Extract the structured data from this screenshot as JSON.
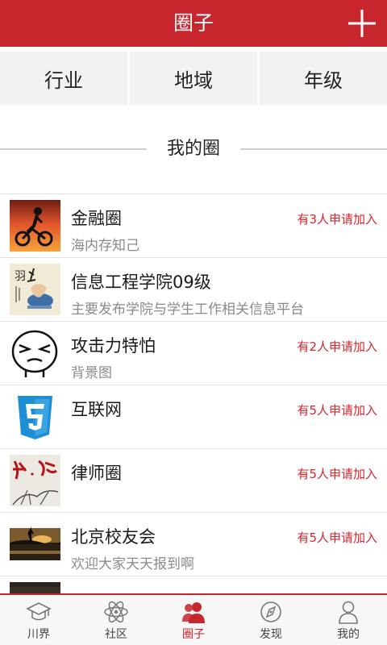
{
  "header": {
    "title": "圈子",
    "add_icon": "plus-icon"
  },
  "filters": [
    {
      "label": "行业"
    },
    {
      "label": "地域"
    },
    {
      "label": "年级"
    }
  ],
  "section": {
    "title": "我的圈"
  },
  "circles": [
    {
      "name": "金融圈",
      "desc": "海内存知己",
      "request": "有3人申请加入",
      "thumb": "cyclist-sunset-image"
    },
    {
      "name": "信息工程学院09级",
      "desc": "主要发布学院与学生工作相关信息平台",
      "request": "",
      "thumb": "calligraphy-painting-image"
    },
    {
      "name": "攻击力特怕",
      "desc": "背景图",
      "request": "有2人申请加入",
      "thumb": "meme-face-image"
    },
    {
      "name": "互联网",
      "desc": "",
      "request": "有5人申请加入",
      "thumb": "html5-logo-image"
    },
    {
      "name": "律师圈",
      "desc": "",
      "request": "有5人申请加入",
      "thumb": "law-calligraphy-image"
    },
    {
      "name": "北京校友会",
      "desc": "欢迎大家天天报到啊",
      "request": "有5人申请加入",
      "thumb": "lake-sunset-image"
    },
    {
      "name": "",
      "desc": "",
      "request": "",
      "thumb": "dark-photo-image"
    }
  ],
  "tabs": [
    {
      "label": "川界",
      "icon": "graduation-cap-icon",
      "active": false
    },
    {
      "label": "社区",
      "icon": "atom-icon",
      "active": false
    },
    {
      "label": "圈子",
      "icon": "people-icon",
      "active": true
    },
    {
      "label": "发现",
      "icon": "compass-icon",
      "active": false
    },
    {
      "label": "我的",
      "icon": "person-icon",
      "active": false
    }
  ],
  "colors": {
    "brand": "#c6262c",
    "request_text": "#d6262d",
    "muted_text": "#8a8a8a"
  }
}
